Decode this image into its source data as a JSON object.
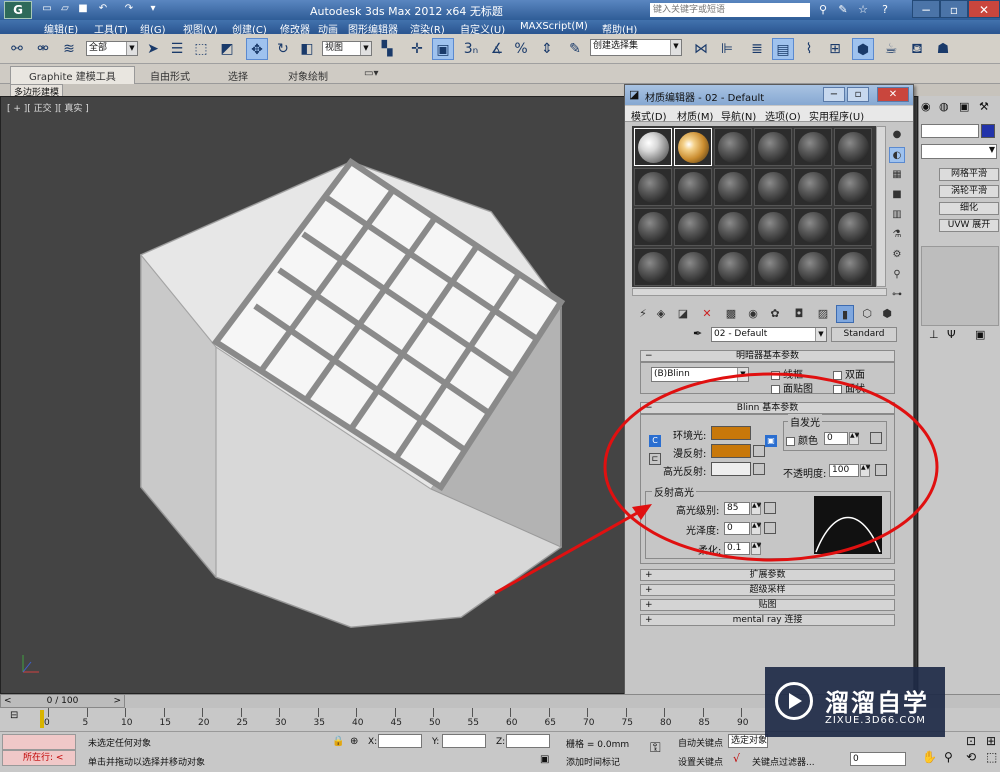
{
  "titlebar": {
    "app_icon": "3ds-max-logo-icon",
    "app_icon_text": "G",
    "title": "Autodesk 3ds Max  2012 x64     无标题",
    "search_placeholder": "键入关键字或短语",
    "icons": [
      "new-icon",
      "open-icon",
      "save-icon",
      "undo-icon",
      "redo-icon",
      "binoculars-icon",
      "star-icon",
      "help-icon"
    ]
  },
  "menubar": {
    "items": [
      "编辑(E)",
      "工具(T)",
      "组(G)",
      "视图(V)",
      "创建(C)",
      "修改器",
      "动画",
      "图形编辑器",
      "渲染(R)",
      "自定义(U)",
      "MAXScript(M)",
      "帮助(H)"
    ]
  },
  "toolbar": {
    "selection_filter": "全部",
    "ref_coord": "视图",
    "named_selection": "创建选择集"
  },
  "ribbon": {
    "tabs": [
      "Graphite 建模工具",
      "自由形式",
      "选择",
      "对象绘制"
    ],
    "subtab": "多边形建模"
  },
  "viewport": {
    "label": "[ + ][ 正交 ][ 真实 ]"
  },
  "command_panel": {
    "buttons": [
      "网格平滑",
      "涡轮平滑",
      "细化",
      "UVW 展开"
    ]
  },
  "material_editor": {
    "title": "材质编辑器 - 02 - Default",
    "menu": [
      "模式(D)",
      "材质(M)",
      "导航(N)",
      "选项(O)",
      "实用程序(U)"
    ],
    "material_name": "02 - Default",
    "material_type": "Standard",
    "shader_rollout": {
      "title": "明暗器基本参数",
      "shader": "(B)Blinn",
      "wire": "线框",
      "two_sided": "双面",
      "face_map": "面贴图",
      "faceted": "面状"
    },
    "blinn_rollout": {
      "title": "Blinn 基本参数",
      "self_illum_group": "自发光",
      "ambient": "环境光:",
      "diffuse": "漫反射:",
      "specular": "高光反射:",
      "color_label": "颜色",
      "self_illum_value": "0",
      "opacity_label": "不透明度:",
      "opacity_value": "100",
      "ambient_color": "#c8780a",
      "diffuse_color": "#c8780a",
      "specular_color": "#eeeeee",
      "lock_button": "C"
    },
    "specular_group": {
      "title": "反射高光",
      "level_label": "高光级别:",
      "level_value": "85",
      "gloss_label": "光泽度:",
      "gloss_value": "0",
      "soften_label": "柔化:",
      "soften_value": "0.1"
    },
    "collapsed_rollouts": [
      "扩展参数",
      "超级采样",
      "贴图",
      "mental ray 连接"
    ]
  },
  "timeline": {
    "slider": "0 / 100",
    "ticks": [
      "0",
      "5",
      "10",
      "15",
      "20",
      "25",
      "30",
      "35",
      "40",
      "45",
      "50",
      "55",
      "60",
      "65",
      "70",
      "75",
      "80",
      "85",
      "90"
    ]
  },
  "statusbar": {
    "selection_status": "未选定任何对象",
    "prompt": "单击并拖动以选择并移动对象",
    "x_label": "X:",
    "y_label": "Y:",
    "z_label": "Z:",
    "grid": "栅格 = 0.0mm",
    "auto_key": "自动关键点",
    "selected": "选定对象",
    "set_key": "设置关键点",
    "key_filters": "关键点过滤器...",
    "add_time_tag": "添加时间标记",
    "frame": "0",
    "script_label": "所在行: <"
  },
  "watermark": {
    "cn": "溜溜自学",
    "en": "ZIXUE.3D66.COM",
    "logo": "play-logo-icon"
  },
  "colors": {
    "annotation_red": "#e01010",
    "title_blue": "#2f5d97"
  }
}
